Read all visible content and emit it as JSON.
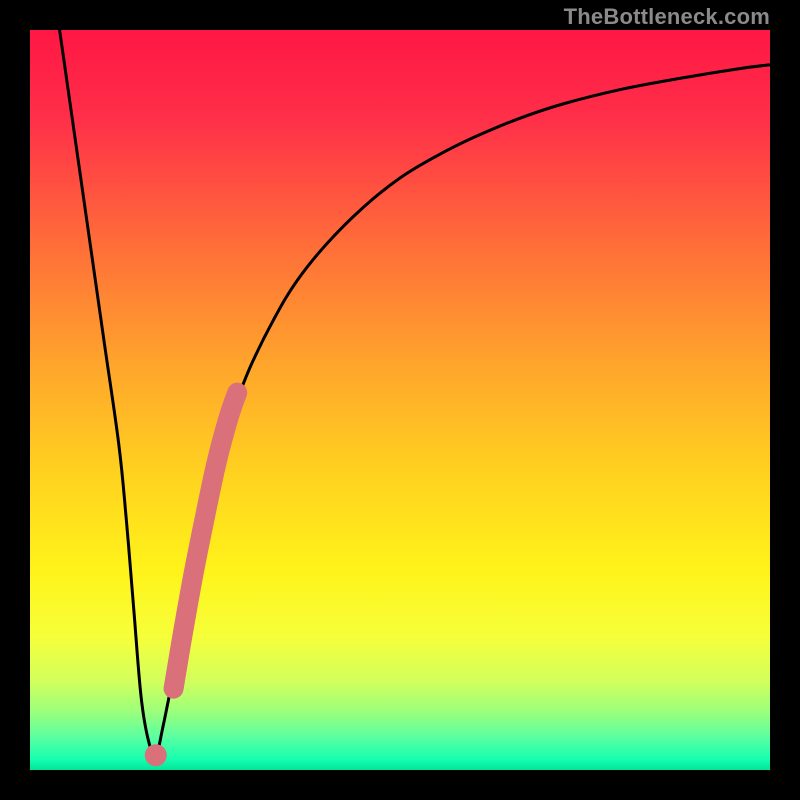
{
  "watermark": "TheBottleneck.com",
  "colors": {
    "frame": "#000000",
    "watermark": "#8a8a8a",
    "curve": "#000000",
    "overlay": "#d9707a",
    "gradient_stops": [
      {
        "offset": 0.0,
        "color": "#ff1744"
      },
      {
        "offset": 0.12,
        "color": "#ff2f49"
      },
      {
        "offset": 0.28,
        "color": "#ff6a3a"
      },
      {
        "offset": 0.45,
        "color": "#ffa42c"
      },
      {
        "offset": 0.6,
        "color": "#ffd21f"
      },
      {
        "offset": 0.73,
        "color": "#fff31a"
      },
      {
        "offset": 0.82,
        "color": "#f6ff3a"
      },
      {
        "offset": 0.88,
        "color": "#d2ff5c"
      },
      {
        "offset": 0.92,
        "color": "#9dff7a"
      },
      {
        "offset": 0.955,
        "color": "#5cffa0"
      },
      {
        "offset": 0.985,
        "color": "#17ffb0"
      },
      {
        "offset": 1.0,
        "color": "#00e59a"
      }
    ]
  },
  "chart_data": {
    "type": "line",
    "title": "",
    "xlabel": "",
    "ylabel": "",
    "xlim": [
      0,
      100
    ],
    "ylim": [
      0,
      100
    ],
    "series": [
      {
        "name": "bottleneck-curve",
        "x": [
          4,
          6,
          8,
          10,
          12,
          13,
          14,
          15,
          16,
          17,
          18,
          20,
          22,
          24,
          26,
          28,
          30,
          33,
          36,
          40,
          45,
          50,
          55,
          60,
          66,
          72,
          80,
          88,
          96,
          100
        ],
        "y": [
          100,
          86,
          72,
          58,
          44,
          34,
          22,
          10,
          4,
          2,
          6,
          16,
          26,
          36,
          44,
          50,
          55,
          61,
          66,
          71,
          76,
          80,
          83,
          85.5,
          88,
          90,
          92,
          93.5,
          94.8,
          95.3
        ]
      },
      {
        "name": "highlight-segment",
        "x": [
          17.0,
          17.8,
          18.6,
          19.4,
          20.4,
          22.0,
          23.6,
          25.2,
          26.8,
          28.0
        ],
        "y": [
          2.0,
          3.0,
          6.5,
          11.0,
          17.0,
          26.0,
          34.0,
          41.5,
          47.5,
          51.0
        ]
      }
    ]
  }
}
